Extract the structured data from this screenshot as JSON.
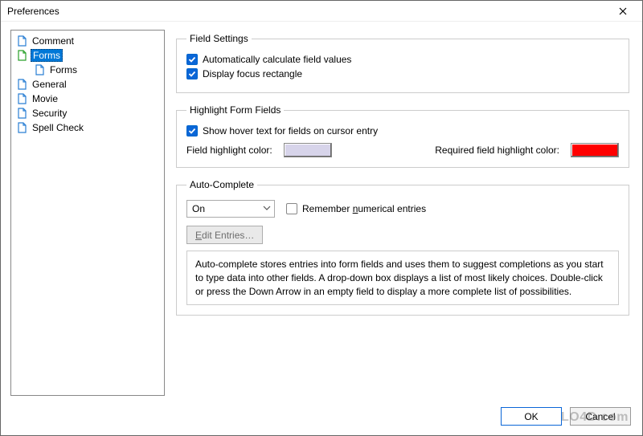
{
  "window": {
    "title": "Preferences"
  },
  "sidebar": {
    "items": [
      {
        "label": "Comment",
        "iconColor": "#2a7fd4"
      },
      {
        "label": "Forms",
        "iconColor": "#2aa02a",
        "selected": true
      },
      {
        "label": "Forms",
        "iconColor": "#2a7fd4",
        "child": true
      },
      {
        "label": "General",
        "iconColor": "#2a7fd4"
      },
      {
        "label": "Movie",
        "iconColor": "#2a7fd4"
      },
      {
        "label": "Security",
        "iconColor": "#2a7fd4"
      },
      {
        "label": "Spell Check",
        "iconColor": "#2a7fd4"
      }
    ]
  },
  "fieldSettings": {
    "legend": "Field Settings",
    "autoCalc": "Automatically calculate field values",
    "focusRect": "Display focus rectangle"
  },
  "highlight": {
    "legend": "Highlight Form Fields",
    "hoverText": "Show hover text for fields on cursor entry",
    "fieldLabel": "Field highlight color:",
    "fieldColor": "#d7d4ea",
    "requiredLabel": "Required field highlight color:",
    "requiredColor": "#ff0000"
  },
  "autoComplete": {
    "legend": "Auto-Complete",
    "selectValue": "On",
    "remember": "Remember numerical entries",
    "editEntries": "Edit Entries…",
    "description": "Auto-complete stores entries into form fields and uses them to suggest completions as you start to type data into other fields. A drop-down box displays a list of most likely choices. Double-click or press the Down Arrow in an empty field to display a more complete list of possibilities."
  },
  "buttons": {
    "ok": "OK",
    "cancel": "Cancel"
  },
  "watermark": "LO4D.com"
}
